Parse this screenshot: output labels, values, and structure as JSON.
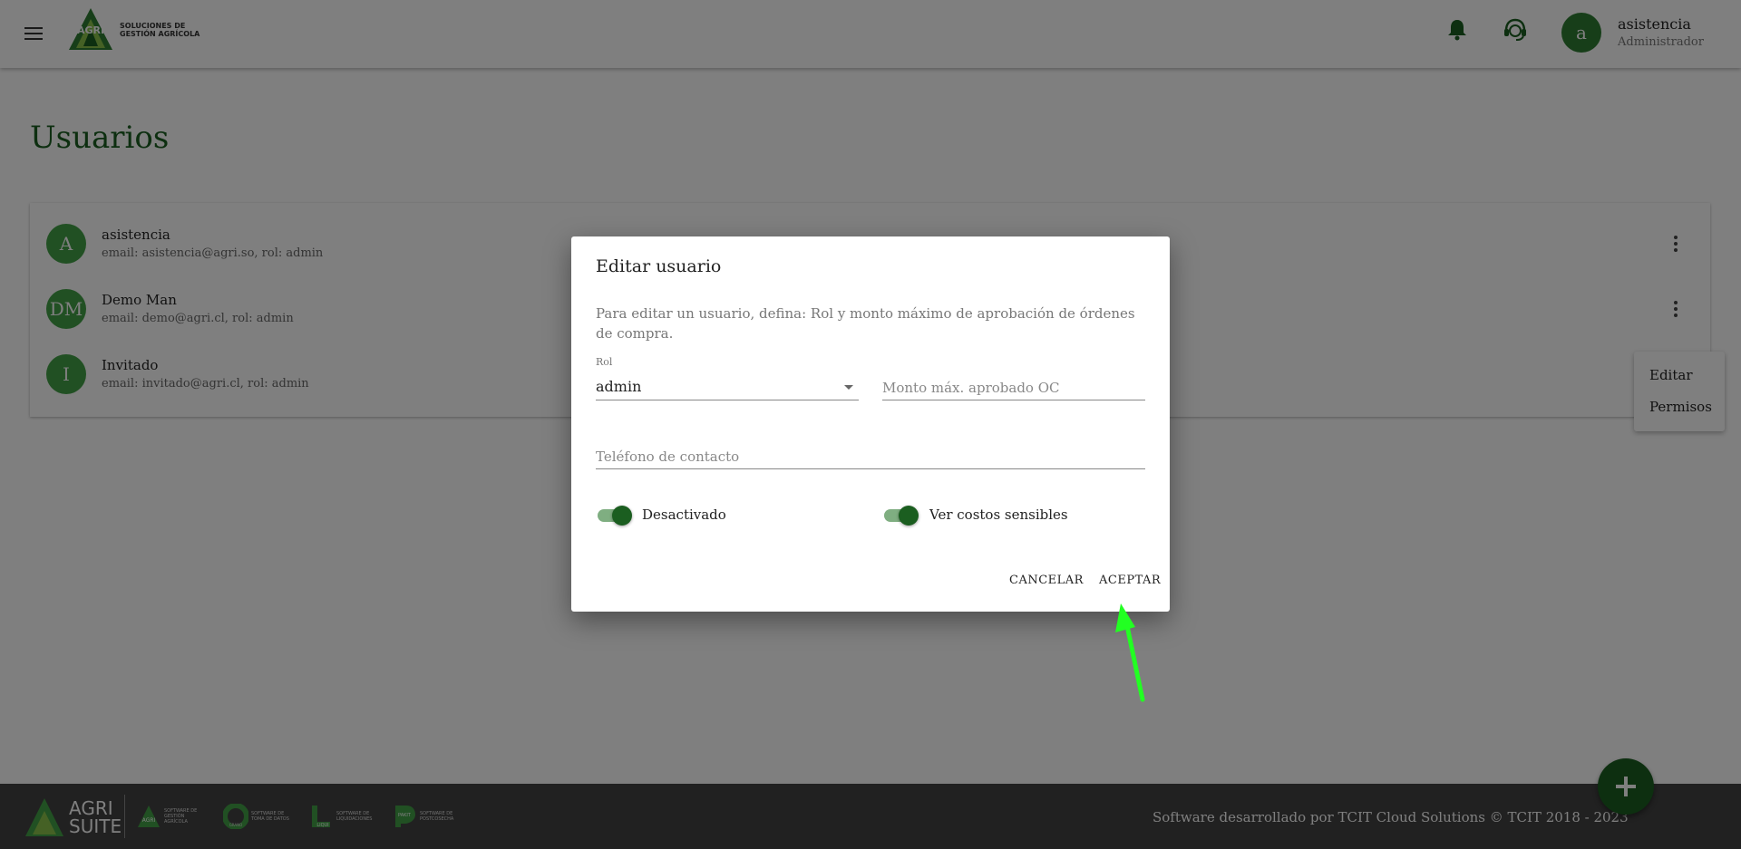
{
  "header": {
    "logo_word": "AGRI",
    "logo_text": "SOLUCIONES DE GESTIÓN AGRÍCOLA",
    "user_initial": "a",
    "user_name": "asistencia",
    "user_role": "Administrador"
  },
  "page": {
    "title": "Usuarios"
  },
  "users": [
    {
      "initials": "A",
      "name": "asistencia",
      "email": "email: asistencia@agri.so, rol: admin"
    },
    {
      "initials": "DM",
      "name": "Demo Man",
      "email": "email: demo@agri.cl, rol: admin"
    },
    {
      "initials": "I",
      "name": "Invitado",
      "email": "email: invitado@agri.cl, rol: admin"
    }
  ],
  "context_menu": {
    "items": [
      "Editar",
      "Permisos"
    ]
  },
  "dialog": {
    "title": "Editar usuario",
    "description": "Para editar un usuario, defina: Rol y monto máximo de aprobación de órdenes de compra.",
    "role_label": "Rol",
    "role_value": "admin",
    "monto_placeholder": "Monto máx. aprobado OC",
    "phone_placeholder": "Teléfono de contacto",
    "toggle1_label": "Desactivado",
    "toggle2_label": "Ver costos sensibles",
    "toggle1_on": true,
    "toggle2_on": true,
    "cancel_label": "CANCELAR",
    "accept_label": "ACEPTAR"
  },
  "footer": {
    "suite_line1": "AGRI",
    "suite_line2": "SUITE",
    "products": [
      {
        "name": "AGRI",
        "text": "SOFTWARE DE GESTIÓN AGRÍCOLA"
      },
      {
        "name": "GRANO",
        "text": "SOFTWARE DE TOMA DE DATOS"
      },
      {
        "name": "LIQUI",
        "text": "SOFTWARE DE LIQUIDACIONES"
      },
      {
        "name": "PAKIT",
        "text": "SOFTWARE DE POSTCOSECHA"
      }
    ],
    "credit": "Software desarrollado por TCIT Cloud Solutions © TCIT 2018 - 2023"
  },
  "colors": {
    "primary_dark": "#1b5e20",
    "primary": "#2e7d32",
    "avatar": "#43a047",
    "annotation_arrow": "#22ff22"
  }
}
